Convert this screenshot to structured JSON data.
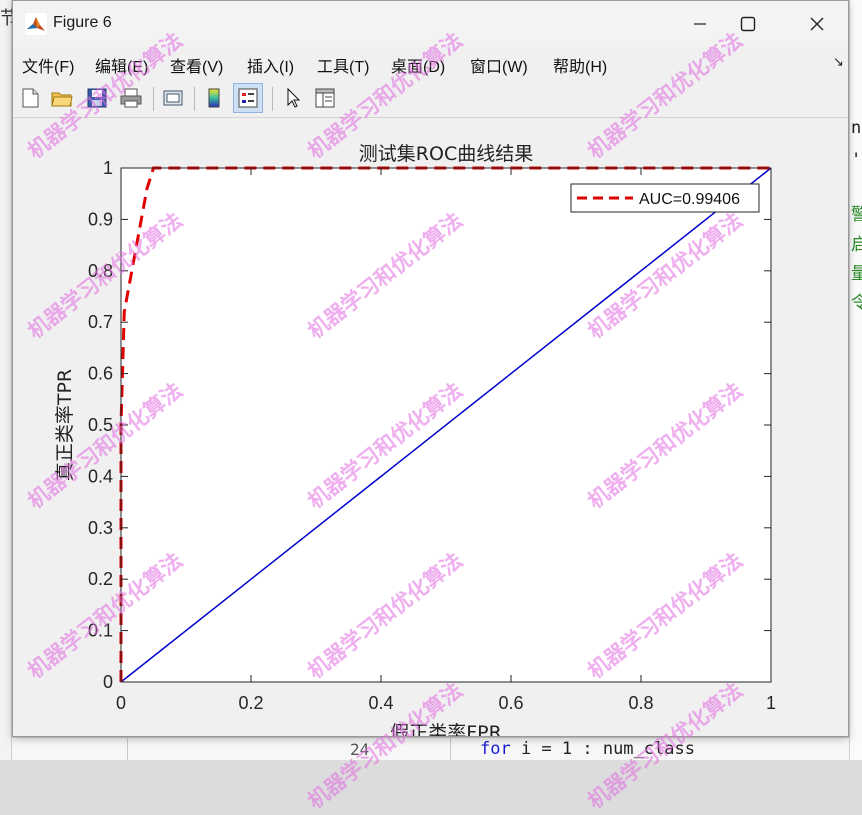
{
  "window": {
    "title": "Figure 6"
  },
  "menu": {
    "items": [
      "文件(F)",
      "编辑(E)",
      "查看(V)",
      "插入(I)",
      "工具(T)",
      "桌面(D)",
      "窗口(W)",
      "帮助(H)"
    ]
  },
  "toolbar": {
    "buttons": [
      "new-figure",
      "open",
      "save",
      "print",
      "link",
      "colorbar",
      "legend",
      "pointer",
      "property-editor"
    ]
  },
  "background": {
    "left_glyph": "节",
    "right_glyphs": [
      "n,",
      "',",
      "警",
      "启",
      "量",
      "令"
    ],
    "line_number": "24",
    "code_keyword": "for",
    "code_rest": " i = 1 : num_class"
  },
  "watermark": "机器学习和优化算法",
  "chart_data": {
    "type": "line",
    "title": "测试集ROC曲线结果",
    "xlabel": "假正类率FPR",
    "ylabel": "真正类率TPR",
    "xlim": [
      0,
      1
    ],
    "ylim": [
      0,
      1
    ],
    "x_ticks": [
      "0",
      "0.2",
      "0.4",
      "0.6",
      "0.8",
      "1"
    ],
    "y_ticks": [
      "0",
      "0.1",
      "0.2",
      "0.3",
      "0.4",
      "0.5",
      "0.6",
      "0.7",
      "0.8",
      "0.9",
      "1"
    ],
    "grid": false,
    "legend_position": "top-right",
    "series": [
      {
        "name": "AUC=0.99406",
        "color": "#e00000",
        "style": "dashed",
        "x": [
          0,
          0,
          0.005,
          0.04,
          0.05,
          1
        ],
        "y": [
          0,
          0.5,
          0.72,
          0.96,
          1,
          1
        ]
      },
      {
        "color": "#0000cc",
        "style": "solid",
        "x": [
          0,
          1
        ],
        "y": [
          0,
          1
        ]
      }
    ]
  }
}
